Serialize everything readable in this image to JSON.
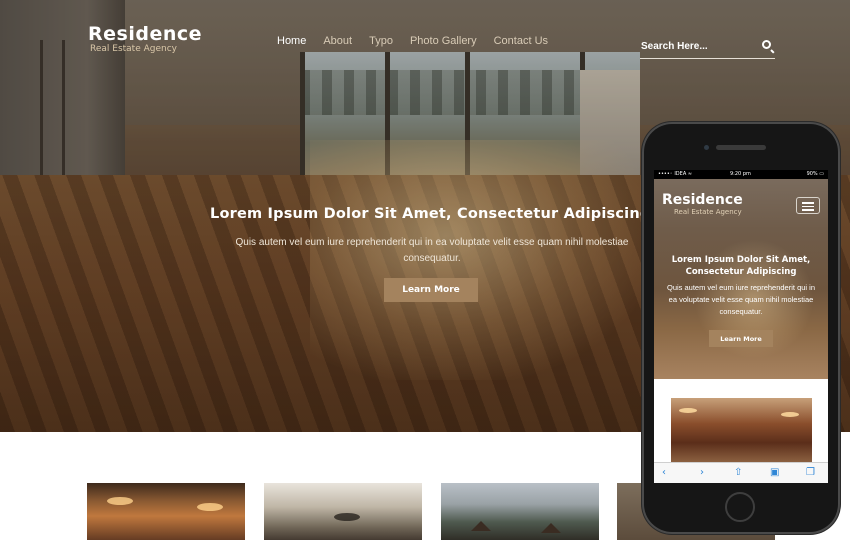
{
  "header": {
    "logo_title": "Residence",
    "logo_subtitle": "Real Estate Agency",
    "nav": [
      {
        "label": "Home",
        "active": true
      },
      {
        "label": "About",
        "active": false
      },
      {
        "label": "Typo",
        "active": false
      },
      {
        "label": "Photo Gallery",
        "active": false
      },
      {
        "label": "Contact Us",
        "active": false
      }
    ],
    "search": {
      "placeholder": "Search Here...",
      "icon": "search-icon"
    }
  },
  "hero": {
    "title": "Lorem Ipsum Dolor Sit Amet, Consectetur Adipiscing",
    "description": "Quis autem vel eum iure reprehenderit qui in ea voluptate velit esse quam nihil molestiae consequatur.",
    "button_label": "Learn More"
  },
  "mobile": {
    "status": {
      "carrier": "••••◦ IDEA ≈",
      "time": "9:20 pm",
      "battery": "90% ▭"
    },
    "logo_title": "Residence",
    "logo_subtitle": "Real Estate Agency",
    "menu_icon": "hamburger-icon",
    "hero_title": "Lorem Ipsum Dolor Sit Amet, Consectetur Adipiscing",
    "hero_description": "Quis autem vel eum iure reprehenderit qui in ea voluptate velit esse quam nihil molestiae consequatur.",
    "button_label": "Learn More",
    "toolbar_icons": [
      "back-icon",
      "forward-icon",
      "share-icon",
      "bookmarks-icon",
      "tabs-icon"
    ]
  },
  "colors": {
    "accent": "#a4835e",
    "nav_text": "#d8cbb6",
    "active_nav": "#ffffff",
    "ios_blue": "#2f86d6"
  }
}
